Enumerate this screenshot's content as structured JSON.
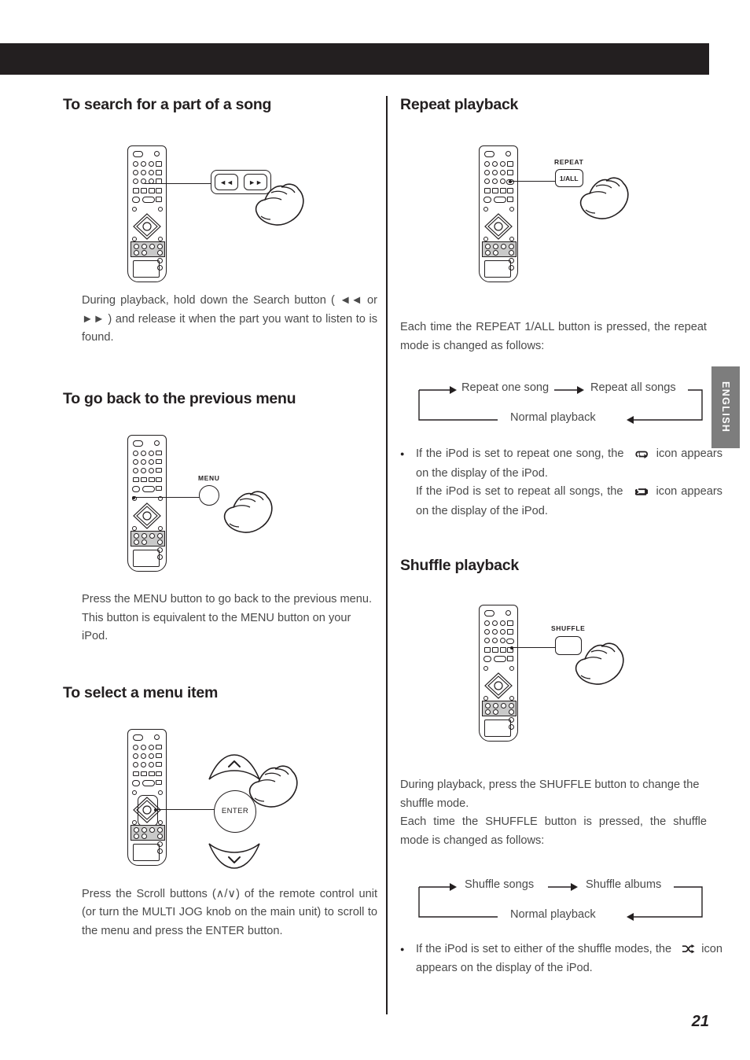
{
  "document": {
    "page_number": "21",
    "language_tab": "ENGLISH"
  },
  "left_column": {
    "sections": [
      {
        "heading": "To search for a part of a song",
        "callout_label": "",
        "button_glyphs": [
          "◄◄",
          "►►"
        ],
        "paragraphs": [
          "During playback, hold down the Search button ( ◄◄ or ►► ) and release it when the part you want to listen to is found."
        ]
      },
      {
        "heading": "To go back to the previous menu",
        "callout_label": "MENU",
        "paragraphs": [
          "Press the MENU button to go back to the previous menu.",
          "This button is equivalent to the MENU button on your iPod."
        ]
      },
      {
        "heading": "To select a menu item",
        "callout_label": "ENTER",
        "paragraphs": [
          "Press the Scroll buttons (∧/∨) of the remote control unit (or turn the MULTI JOG knob on the main unit) to scroll to the menu and press the ENTER button."
        ]
      }
    ]
  },
  "right_column": {
    "sections": [
      {
        "heading": "Repeat playback",
        "callout_label": "REPEAT",
        "callout_button_text": "1/ALL",
        "paragraphs": [
          "Each time the REPEAT 1/ALL button is pressed, the repeat mode is changed as follows:"
        ],
        "flow": {
          "step1": "Repeat one song",
          "step2": "Repeat all songs",
          "step3": "Normal playback"
        },
        "notes": [
          {
            "text_before": "If the iPod is set to repeat one song, the",
            "icon": "repeat-one-icon",
            "text_after": "icon appears on the display of the iPod."
          },
          {
            "text_before": "If the iPod is set to repeat all songs, the",
            "icon": "repeat-all-icon",
            "text_after": "icon appears on the display of the iPod."
          }
        ]
      },
      {
        "heading": "Shuffle playback",
        "callout_label": "SHUFFLE",
        "callout_button_text": "",
        "paragraphs": [
          "During playback, press the SHUFFLE button to change the shuffle mode.",
          "Each time the SHUFFLE button is pressed, the shuffle mode is changed as follows:"
        ],
        "flow": {
          "step1": "Shuffle songs",
          "step2": "Shuffle albums",
          "step3": "Normal playback"
        },
        "notes": [
          {
            "text_before": "If the iPod is set to either of the shuffle modes, the",
            "icon": "shuffle-icon",
            "text_after": "icon appears on the display of the iPod."
          }
        ]
      }
    ]
  }
}
